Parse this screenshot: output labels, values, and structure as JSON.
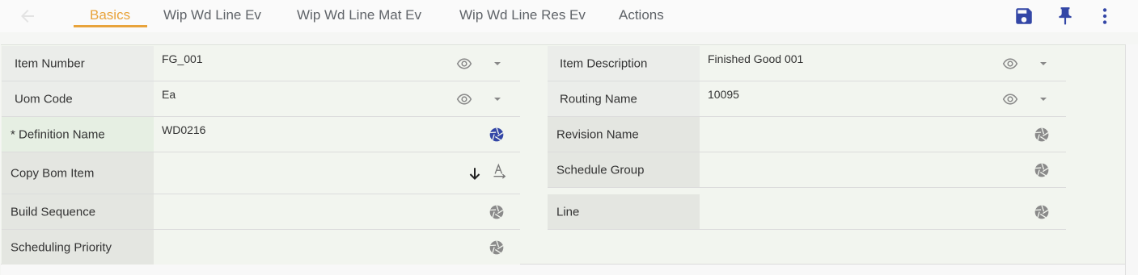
{
  "tabs": [
    {
      "label": "Basics",
      "active": true
    },
    {
      "label": "Wip Wd Line Ev",
      "active": false
    },
    {
      "label": "Wip Wd Line Mat Ev",
      "active": false
    },
    {
      "label": "Wip Wd Line Res Ev",
      "active": false
    },
    {
      "label": "Actions",
      "active": false
    }
  ],
  "colors": {
    "accent": "#e8a33b",
    "icon_blue": "#3346a6",
    "icon_gray": "#8a8a8a"
  },
  "form": {
    "left": [
      {
        "label": "Item Number",
        "value": "FG_001",
        "icons": [
          "eye-icon",
          "caret-down-icon"
        ]
      },
      {
        "label": "Uom Code",
        "value": "Ea",
        "icons": [
          "eye-icon",
          "caret-down-icon"
        ]
      },
      {
        "label": "* Definition Name",
        "value": "WD0216",
        "required": true,
        "icons": [
          "aperture-icon"
        ]
      },
      {
        "label": "Copy Bom Item",
        "value": "",
        "icons": [
          "arrow-down-icon",
          "text-format-icon"
        ]
      },
      {
        "label": "Build Sequence",
        "value": "",
        "icons": [
          "aperture-icon"
        ]
      },
      {
        "label": "Scheduling Priority",
        "value": "",
        "icons": [
          "aperture-icon"
        ]
      }
    ],
    "right": [
      {
        "label": "Item Description",
        "value": "Finished Good 001",
        "icons": [
          "eye-icon",
          "caret-down-icon"
        ]
      },
      {
        "label": "Routing Name",
        "value": "10095",
        "icons": [
          "eye-icon",
          "caret-down-icon"
        ]
      },
      {
        "label": "Revision Name",
        "value": "",
        "icons": [
          "aperture-icon"
        ]
      },
      {
        "label": "Schedule Group",
        "value": "",
        "icons": [
          "aperture-icon"
        ]
      },
      {
        "label": "Line",
        "value": "",
        "icons": [
          "aperture-icon"
        ]
      }
    ]
  }
}
